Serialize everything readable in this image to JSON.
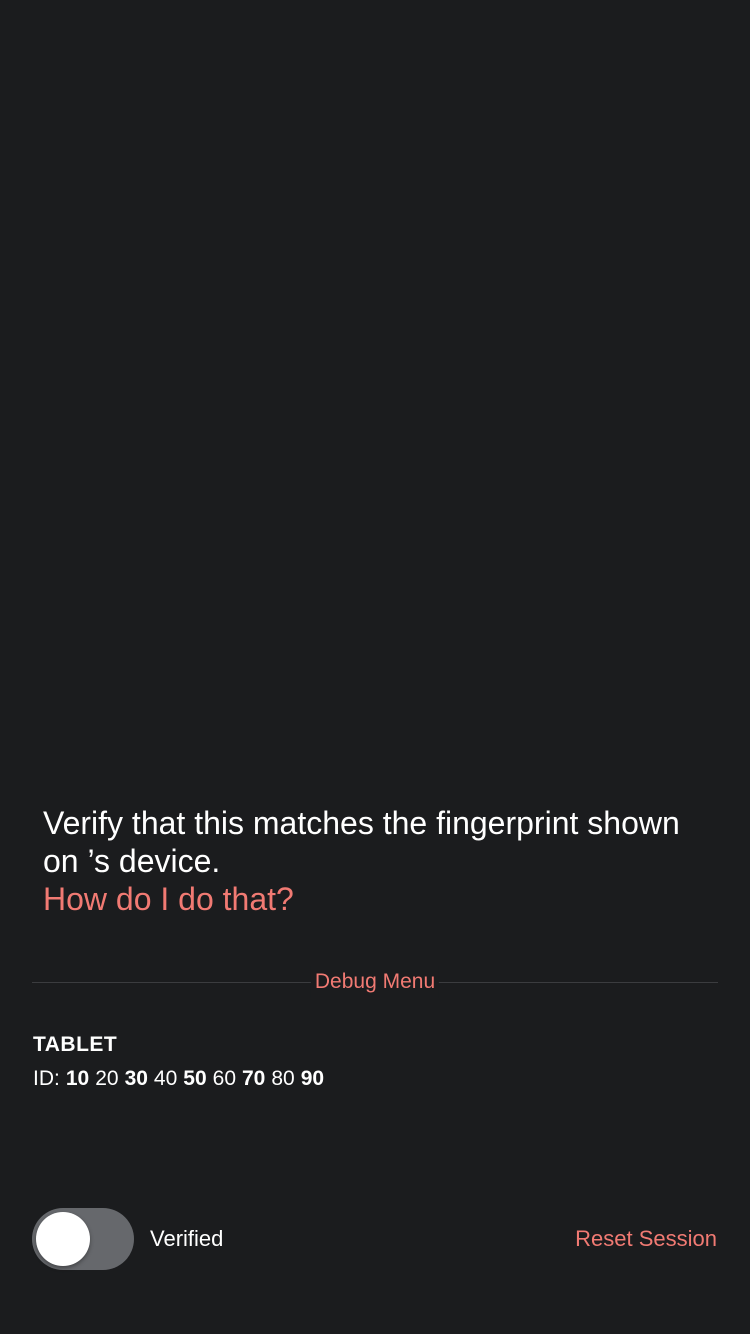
{
  "instructions": {
    "line1": "Verify that this matches the fingerprint shown",
    "line2": "on ’s device.",
    "help_link": "How do I do that?"
  },
  "debug_menu": {
    "label": "Debug Menu"
  },
  "device": {
    "name": "TABLET",
    "id_label": "ID:",
    "id_segments": [
      {
        "text": "10",
        "bold": true
      },
      {
        "text": "20",
        "bold": false
      },
      {
        "text": "30",
        "bold": true
      },
      {
        "text": "40",
        "bold": false
      },
      {
        "text": "50",
        "bold": true
      },
      {
        "text": "60",
        "bold": false
      },
      {
        "text": "70",
        "bold": true
      },
      {
        "text": "80",
        "bold": false
      },
      {
        "text": "90",
        "bold": true
      }
    ]
  },
  "verification": {
    "toggle_on": false,
    "label": "Verified"
  },
  "actions": {
    "reset_session": "Reset Session"
  },
  "colors": {
    "background": "#1b1c1e",
    "accent": "#f17a73",
    "toggle_off": "#66686c"
  }
}
